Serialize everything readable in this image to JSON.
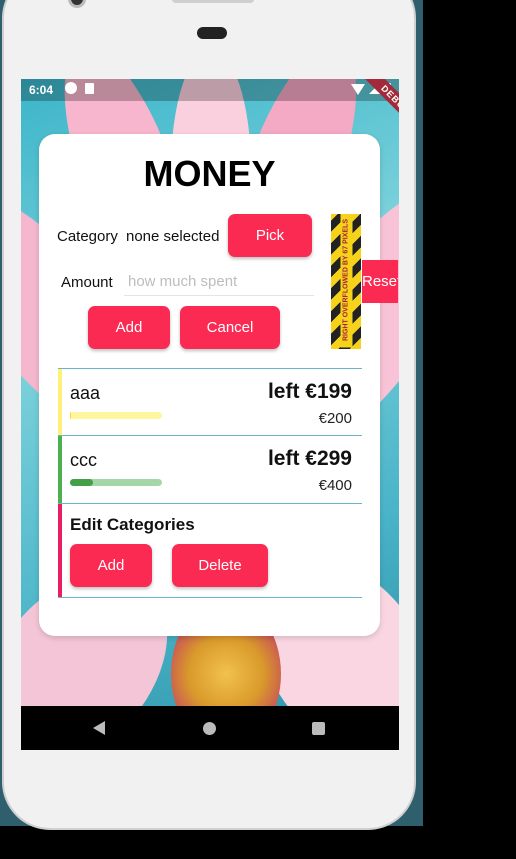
{
  "status_bar": {
    "time": "6:04",
    "debug_label": "DEBUG"
  },
  "card": {
    "title": "MONEY",
    "category_label": "Category",
    "category_value": "none selected",
    "pick_label": "Pick",
    "amount_label": "Amount",
    "amount_placeholder": "how much spent",
    "amount_value": "",
    "add_label": "Add",
    "cancel_label": "Cancel",
    "reset_label": "Reset",
    "overflow_warning": "RIGHT OVERFLOWED BY 67 PIXELS"
  },
  "categories": [
    {
      "name": "aaa",
      "left": "left €199",
      "total": "€200",
      "progress": 0.005,
      "bar_color": "#fff176",
      "fill_color": "#fdd835",
      "track_color": "#fff59d"
    },
    {
      "name": "ccc",
      "left": "left €299",
      "total": "€400",
      "progress": 0.25,
      "bar_color": "#4caf50",
      "fill_color": "#43a047",
      "track_color": "#a5d6a7"
    }
  ],
  "edit": {
    "title": "Edit Categories",
    "add_label": "Add",
    "delete_label": "Delete",
    "bar_color": "#e91e63"
  },
  "colors": {
    "accent": "#fb2a52",
    "divider": "#69b6c8"
  }
}
